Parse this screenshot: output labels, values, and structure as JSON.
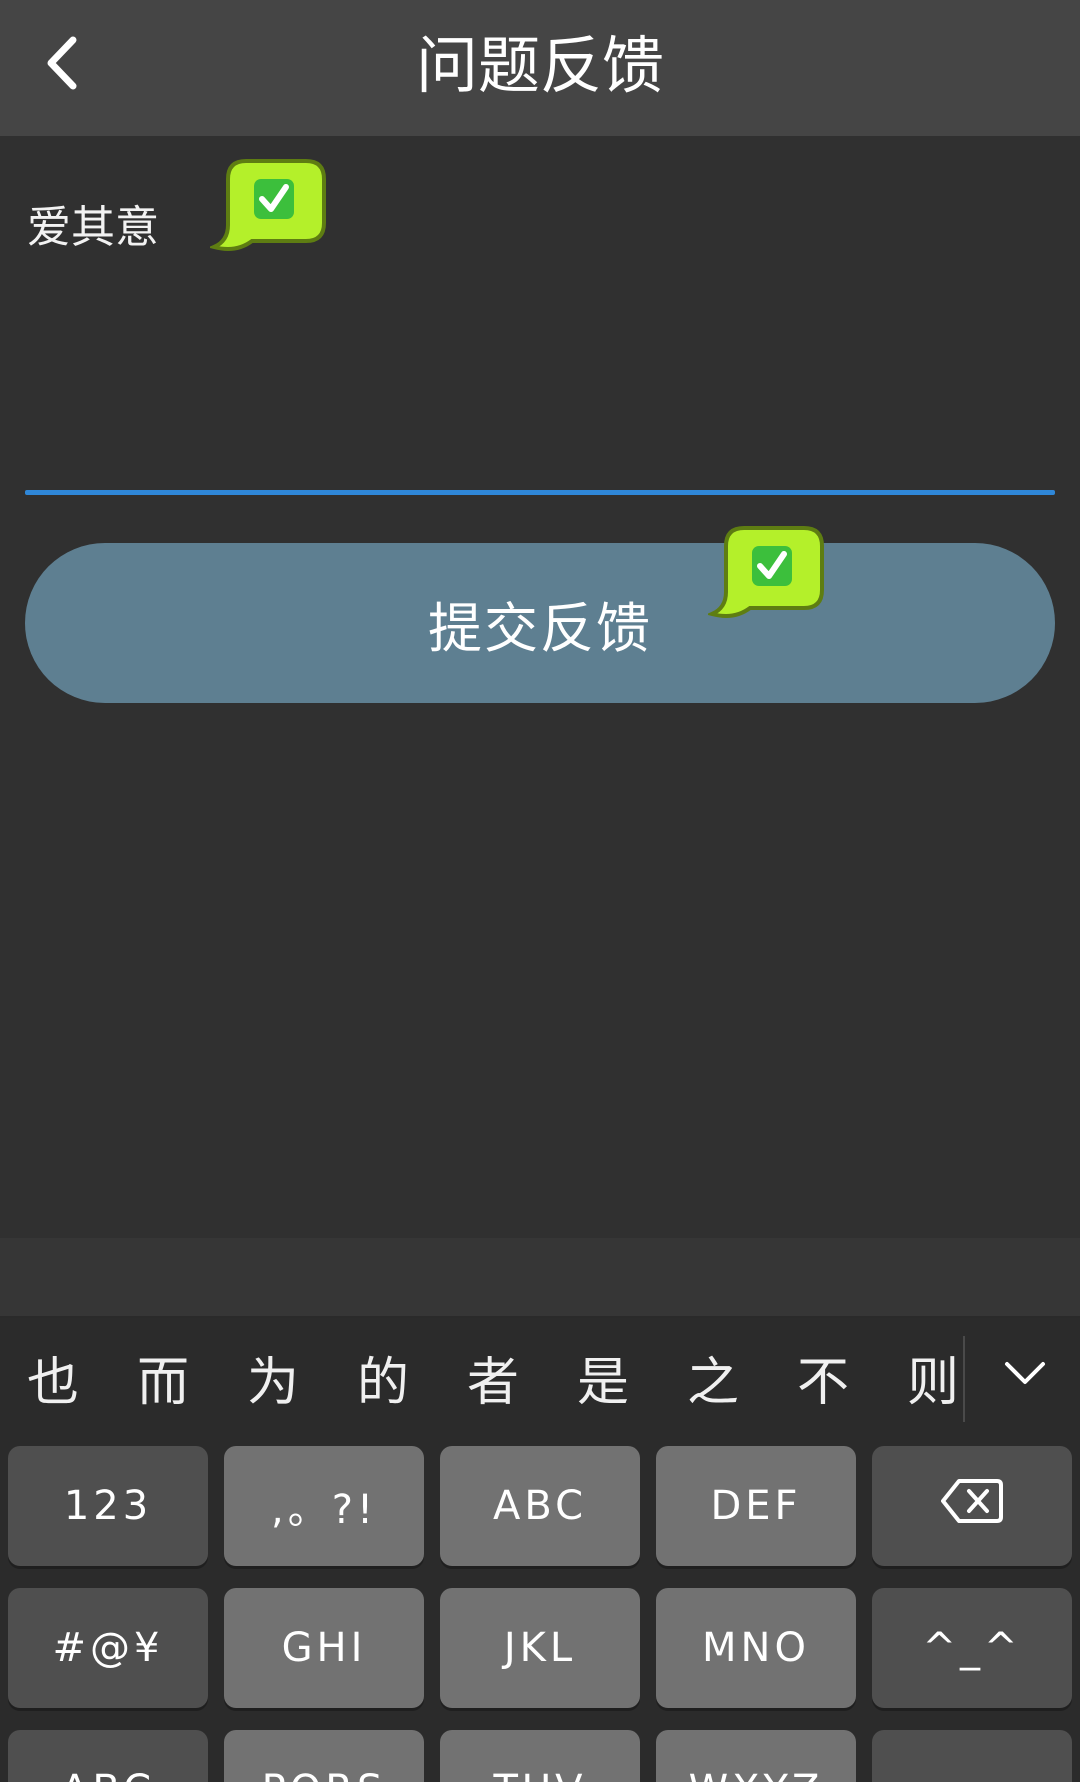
{
  "header": {
    "title": "问题反馈",
    "back_icon": "chevron-left-icon"
  },
  "feedback": {
    "value": "爱其意",
    "underline_color": "#2f87d8"
  },
  "submit": {
    "label": "提交反馈",
    "color": "#5e7f91"
  },
  "overlays": {
    "bubble_icon": "check-speech-bubble-icon",
    "bubble_color": "#b4f02a",
    "check_color": "#3cbf3c"
  },
  "keyboard": {
    "candidates": [
      "也",
      "而",
      "为",
      "的",
      "者",
      "是",
      "之",
      "不",
      "则"
    ],
    "collapse_icon": "chevron-down-icon",
    "row1": [
      "123",
      ",。?!",
      "ABC",
      "DEF"
    ],
    "row2": [
      "#@¥",
      "GHI",
      "JKL",
      "MNO"
    ],
    "row3": [
      "ABC",
      "PQRS",
      "TUV",
      "WXYZ"
    ],
    "delete_icon": "backspace-icon",
    "emoticon_key": "^_^"
  }
}
